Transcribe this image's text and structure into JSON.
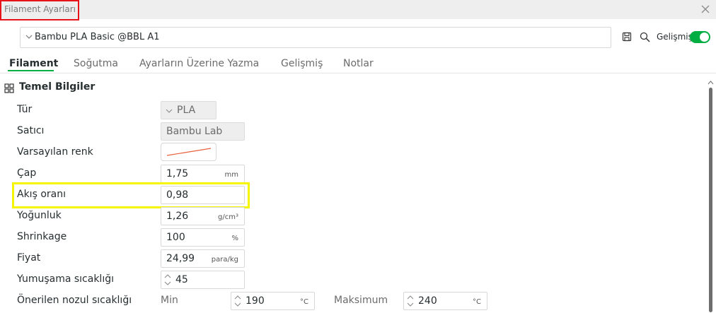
{
  "window": {
    "title": "Filament Ayarları"
  },
  "preset": {
    "name": "Bambu PLA Basic @BBL A1"
  },
  "toolbar": {
    "advanced_label": "Gelişmiş",
    "advanced_on": true,
    "accent": "#00ae42"
  },
  "tabs": [
    {
      "label": "Filament",
      "active": true
    },
    {
      "label": "Soğutma"
    },
    {
      "label": "Ayarların Üzerine Yazma"
    },
    {
      "label": "Gelişmiş"
    },
    {
      "label": "Notlar"
    }
  ],
  "section": {
    "title": "Temel Bilgiler",
    "icon": "grid-icon"
  },
  "fields": {
    "type": {
      "label": "Tür",
      "value": "PLA"
    },
    "vendor": {
      "label": "Satıcı",
      "value": "Bambu Lab"
    },
    "default_color": {
      "label": "Varsayılan renk"
    },
    "diameter": {
      "label": "Çap",
      "value": "1,75",
      "unit": "mm"
    },
    "flow_ratio": {
      "label": "Akış oranı",
      "value": "0,98"
    },
    "density": {
      "label": "Yoğunluk",
      "value": "1,26",
      "unit": "g/cm³"
    },
    "shrinkage": {
      "label": "Shrinkage",
      "value": "100",
      "unit": "%"
    },
    "price": {
      "label": "Fiyat",
      "value": "24,99",
      "unit": "para/kg"
    },
    "softening": {
      "label": "Yumuşama sıcaklığı",
      "value": "45"
    },
    "nozzle_temp": {
      "label": "Önerilen nozul sıcaklığı",
      "min_label": "Min",
      "min_value": "190",
      "max_label": "Maksimum",
      "max_value": "240",
      "unit": "°C"
    }
  },
  "highlights": {
    "title_box": "#e8121b",
    "flow_box": "#f5f500"
  }
}
